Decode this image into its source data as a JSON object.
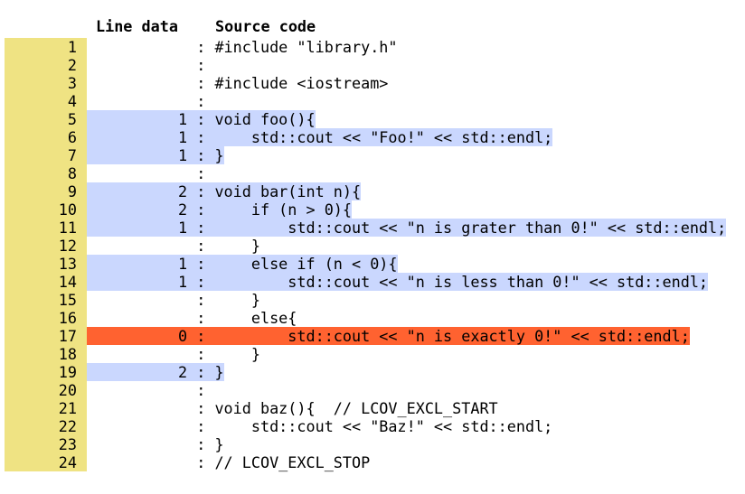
{
  "header": {
    "line_data": "Line data",
    "source_code": "Source code"
  },
  "colors": {
    "line_number_bg": "#efe383",
    "covered": "#cad7fe",
    "uncovered": "#ff6230"
  },
  "rows": [
    {
      "line": "1",
      "count": "",
      "source": "#include \"library.h\"",
      "status": "none"
    },
    {
      "line": "2",
      "count": "",
      "source": "",
      "status": "none"
    },
    {
      "line": "3",
      "count": "",
      "source": "#include <iostream>",
      "status": "none"
    },
    {
      "line": "4",
      "count": "",
      "source": "",
      "status": "none"
    },
    {
      "line": "5",
      "count": "1",
      "source": "void foo(){",
      "status": "covered"
    },
    {
      "line": "6",
      "count": "1",
      "source": "    std::cout << \"Foo!\" << std::endl;",
      "status": "covered"
    },
    {
      "line": "7",
      "count": "1",
      "source": "}",
      "status": "covered"
    },
    {
      "line": "8",
      "count": "",
      "source": "",
      "status": "none"
    },
    {
      "line": "9",
      "count": "2",
      "source": "void bar(int n){",
      "status": "covered"
    },
    {
      "line": "10",
      "count": "2",
      "source": "    if (n > 0){",
      "status": "covered"
    },
    {
      "line": "11",
      "count": "1",
      "source": "        std::cout << \"n is grater than 0!\" << std::endl;",
      "status": "covered"
    },
    {
      "line": "12",
      "count": "",
      "source": "    }",
      "status": "none"
    },
    {
      "line": "13",
      "count": "1",
      "source": "    else if (n < 0){",
      "status": "covered"
    },
    {
      "line": "14",
      "count": "1",
      "source": "        std::cout << \"n is less than 0!\" << std::endl;",
      "status": "covered"
    },
    {
      "line": "15",
      "count": "",
      "source": "    }",
      "status": "none"
    },
    {
      "line": "16",
      "count": "",
      "source": "    else{",
      "status": "none"
    },
    {
      "line": "17",
      "count": "0",
      "source": "        std::cout << \"n is exactly 0!\" << std::endl;",
      "status": "uncovered"
    },
    {
      "line": "18",
      "count": "",
      "source": "    }",
      "status": "none"
    },
    {
      "line": "19",
      "count": "2",
      "source": "}",
      "status": "covered"
    },
    {
      "line": "20",
      "count": "",
      "source": "",
      "status": "none"
    },
    {
      "line": "21",
      "count": "",
      "source": "void baz(){  // LCOV_EXCL_START",
      "status": "none"
    },
    {
      "line": "22",
      "count": "",
      "source": "    std::cout << \"Baz!\" << std::endl;",
      "status": "none"
    },
    {
      "line": "23",
      "count": "",
      "source": "}",
      "status": "none"
    },
    {
      "line": "24",
      "count": "",
      "source": "// LCOV_EXCL_STOP",
      "status": "none"
    }
  ]
}
